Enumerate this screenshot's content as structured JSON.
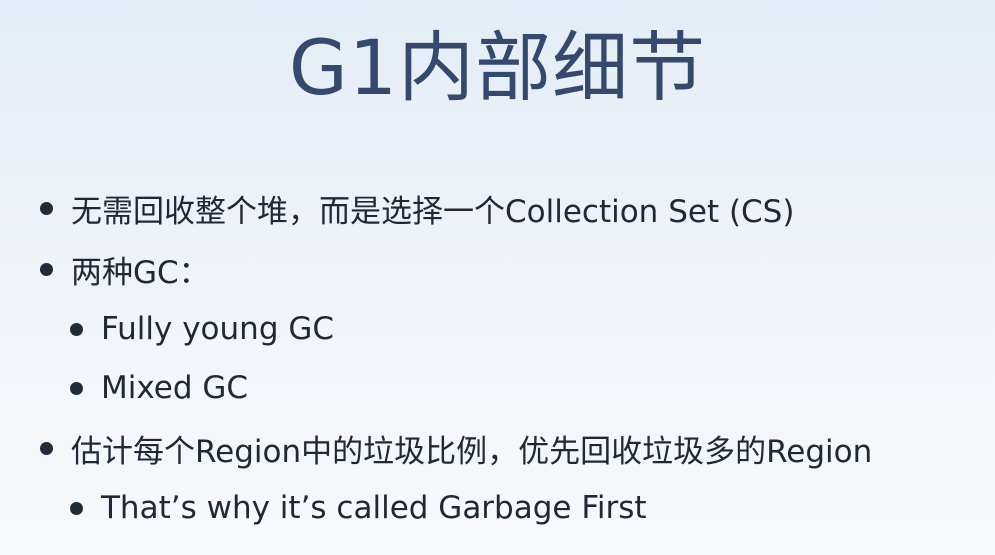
{
  "slide": {
    "title": "G1内部细节",
    "bullets": [
      {
        "level": 1,
        "text": "无需回收整个堆，而是选择一个Collection Set (CS)"
      },
      {
        "level": 1,
        "text": "两种GC："
      },
      {
        "level": 2,
        "text": "Fully young GC"
      },
      {
        "level": 2,
        "text": "Mixed GC"
      },
      {
        "level": 1,
        "text": "估计每个Region中的垃圾比例，优先回收垃圾多的Region"
      },
      {
        "level": 2,
        "text": "That’s why it’s called Garbage First"
      }
    ]
  },
  "colors": {
    "title": "#34496c",
    "text": "#1f2833",
    "background_top": "#e3ecf6",
    "background_bottom": "#f6f8fb"
  }
}
